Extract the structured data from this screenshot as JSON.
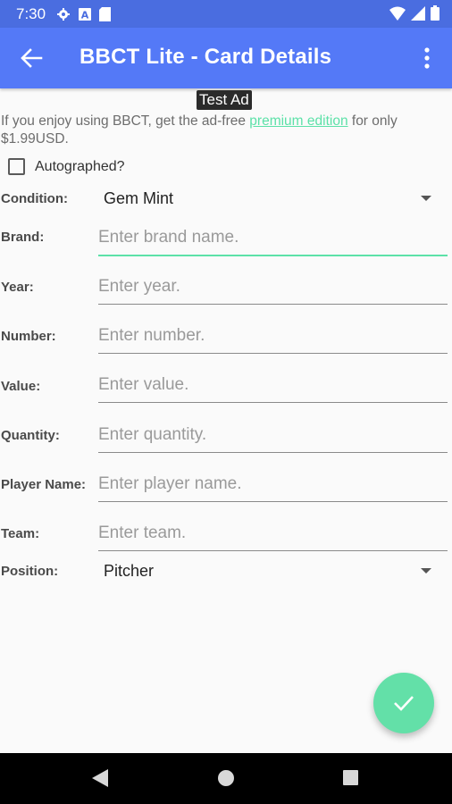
{
  "status_bar": {
    "time": "7:30",
    "left_icons": [
      "gear-icon",
      "a-icon",
      "sd-card-icon"
    ],
    "right_icons": [
      "wifi-icon",
      "signal-icon",
      "battery-icon"
    ]
  },
  "app_bar": {
    "title": "BBCT Lite - Card Details",
    "back_icon": "arrow-left-icon",
    "menu_icon": "more-vert-icon",
    "color": "#5479f7"
  },
  "ad": {
    "badge": "Test Ad",
    "text_before": "If you enjoy using BBCT, get the ad-free ",
    "link": "premium edition",
    "text_after": " for only $1.99USD."
  },
  "autographed": {
    "label": "Autographed?",
    "checked": false
  },
  "condition": {
    "label": "Condition:",
    "value": "Gem Mint"
  },
  "fields": {
    "brand": {
      "label": "Brand:",
      "placeholder": "Enter brand name."
    },
    "year": {
      "label": "Year:",
      "placeholder": "Enter year."
    },
    "number": {
      "label": "Number:",
      "placeholder": "Enter number."
    },
    "value": {
      "label": "Value:",
      "placeholder": "Enter value."
    },
    "quantity": {
      "label": "Quantity:",
      "placeholder": "Enter quantity."
    },
    "player_name": {
      "label": "Player Name:",
      "placeholder": "Enter player name."
    },
    "team": {
      "label": "Team:",
      "placeholder": "Enter team."
    }
  },
  "position": {
    "label": "Position:",
    "value": "Pitcher"
  },
  "fab": {
    "icon": "check-icon",
    "color": "#63e0a8"
  },
  "nav_bar": {
    "icons": [
      "nav-back-icon",
      "nav-home-icon",
      "nav-recents-icon"
    ]
  }
}
